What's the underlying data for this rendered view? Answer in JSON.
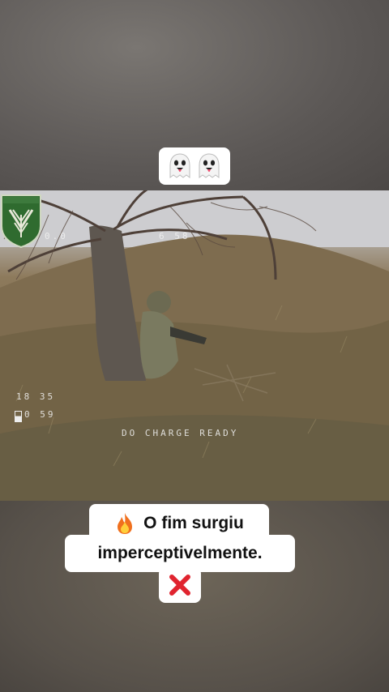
{
  "top_sticker": {
    "emojis": [
      "ghost-icon",
      "ghost-icon"
    ]
  },
  "video": {
    "osd_top_left": "0.0",
    "osd_top_mid": "6 58",
    "osd_left_line1": "18 35",
    "osd_left_line2": "0 59",
    "osd_status": "DO  CHARGE  READY"
  },
  "caption": {
    "line1": "O fim surgiu",
    "line2": "imperceptivelmente.",
    "line1_icon": "fire-icon",
    "line3_icon": "cross-mark-icon"
  },
  "colors": {
    "caption_bg": "#ffffff",
    "caption_text": "#111111",
    "badge_green": "#2f6b2f"
  }
}
